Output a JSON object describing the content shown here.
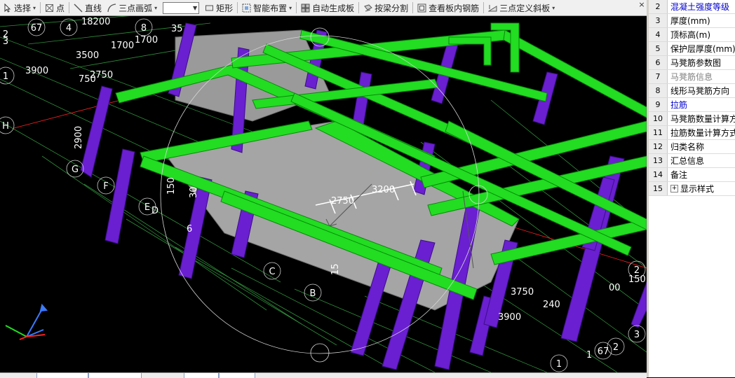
{
  "toolbar": {
    "select": "选择",
    "point": "点",
    "line": "直线",
    "arc3": "三点画弧",
    "rect": "矩形",
    "smart_layout": "智能布置",
    "auto_slab": "自动生成板",
    "split_by_beam": "按梁分割",
    "view_slab_rebar": "查看板内钢筋",
    "slope3": "三点定义斜板",
    "close": "×"
  },
  "properties": {
    "rows": [
      {
        "num": "2",
        "name": "混凝土强度等级",
        "style": "blue"
      },
      {
        "num": "3",
        "name": "厚度(mm)",
        "style": "normal"
      },
      {
        "num": "4",
        "name": "顶标高(m)",
        "style": "normal"
      },
      {
        "num": "5",
        "name": "保护层厚度(mm)",
        "style": "normal"
      },
      {
        "num": "6",
        "name": "马凳筋参数图",
        "style": "normal"
      },
      {
        "num": "7",
        "name": "马凳筋信息",
        "style": "grey"
      },
      {
        "num": "8",
        "name": "线形马凳筋方向",
        "style": "normal"
      },
      {
        "num": "9",
        "name": "拉筋",
        "style": "blue"
      },
      {
        "num": "10",
        "name": "马凳筋数量计算方式",
        "style": "normal"
      },
      {
        "num": "11",
        "name": "拉筋数量计算方式",
        "style": "normal"
      },
      {
        "num": "12",
        "name": "归类名称",
        "style": "normal"
      },
      {
        "num": "13",
        "name": "汇总信息",
        "style": "normal"
      },
      {
        "num": "14",
        "name": "备注",
        "style": "normal"
      },
      {
        "num": "15",
        "name": "显示样式",
        "style": "normal",
        "expander": "+"
      }
    ]
  },
  "canvas": {
    "axis_labels": [
      "2",
      "67",
      "4",
      "8",
      "3",
      "1",
      "H",
      "G",
      "F",
      "E",
      "D",
      "C",
      "B",
      "1",
      "2",
      "67",
      "3",
      "2"
    ],
    "dims": [
      "18200",
      "1700",
      "1700",
      "3500",
      "3900",
      "2750",
      "750",
      "2900",
      "35",
      "150",
      "30",
      "2750",
      "3200",
      "3750",
      "3900",
      "240",
      "150",
      "00",
      "15",
      "6",
      "1"
    ],
    "colors": {
      "beam": "#22dd22",
      "column": "#6a1fd0",
      "slab": "#a5a5a5",
      "grid": "#2f8f3a",
      "axis_red": "#ff2020"
    }
  }
}
